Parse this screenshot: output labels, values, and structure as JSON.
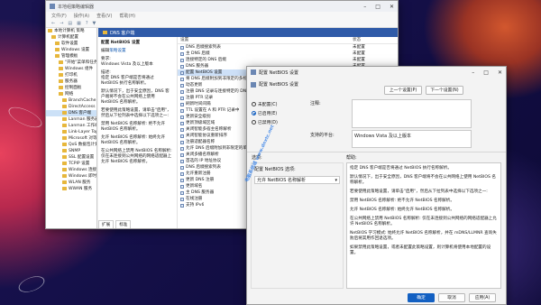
{
  "editor": {
    "title": "本地组策略编辑器",
    "menu": [
      "文件(F)",
      "操作(A)",
      "查看(V)",
      "帮助(H)"
    ],
    "tree": [
      {
        "label": "本地计算机 策略",
        "indent": 0
      },
      {
        "label": "计算机配置",
        "indent": 1
      },
      {
        "label": "软件设置",
        "indent": 2
      },
      {
        "label": "Windows 设置",
        "indent": 2
      },
      {
        "label": "管理模板",
        "indent": 2
      },
      {
        "label": "\"开始\"菜单和任务栏",
        "indent": 3
      },
      {
        "label": "Windows 组件",
        "indent": 3
      },
      {
        "label": "打印机",
        "indent": 3
      },
      {
        "label": "服务器",
        "indent": 3
      },
      {
        "label": "控制面板",
        "indent": 3
      },
      {
        "label": "网络",
        "indent": 3
      },
      {
        "label": "BranchCache",
        "indent": 4
      },
      {
        "label": "DirectAccess 客户端体验设置",
        "indent": 4
      },
      {
        "label": "DNS 客户端",
        "indent": 4,
        "selected": true
      },
      {
        "label": "Lanman 服务器",
        "indent": 4
      },
      {
        "label": "Lanman 工作站",
        "indent": 4
      },
      {
        "label": "Link-Layer Topology",
        "indent": 4
      },
      {
        "label": "Microsoft 对等网络服务",
        "indent": 4
      },
      {
        "label": "QoS 数据包计划程序",
        "indent": 4
      },
      {
        "label": "SNMP",
        "indent": 4
      },
      {
        "label": "SSL 配置设置",
        "indent": 4
      },
      {
        "label": "TCPIP 设置",
        "indent": 4
      },
      {
        "label": "Windows 连接管理器",
        "indent": 4
      },
      {
        "label": "Windows 即时连接",
        "indent": 4
      },
      {
        "label": "WLAN 服务",
        "indent": 4
      },
      {
        "label": "WWAN 服务",
        "indent": 4
      }
    ],
    "panel_header": "DNS 客户端",
    "desc": {
      "heading": "配置 NetBIOS 设置",
      "edit_prefix": "编辑",
      "edit_link": "策略设置",
      "req_label": "要求:",
      "req_value": "Windows Vista 及以上版本",
      "desc_label": "描述:",
      "desc_text": "指定 DNS 客户端是否将通过 NetBIOS 执行名称解析。",
      "default_text": "默认情况下，出于安全原因，DNS 客户端将不会在公共网络上使用 NetBIOS 名称解析。",
      "enable_text": "若要使用此策略设置，请单击\"启用\"，然后从下拉列表中选择以下选项之一:",
      "disable_text": "禁用 NetBIOS 名称解析: 绝不允许 NetBIOS 名称解析。",
      "allow_text": "允许 NetBIOS 名称解析: 始终允许 NetBIOS 名称解析。",
      "public_text": "在公共网络上禁用 NetBIOS 名称解析: 仅在未连接到公共网络的网络适配器上允许 NetBIOS 名称解析。"
    },
    "settings_col": "设置",
    "state_col": "状态",
    "settings": [
      {
        "name": "DNS 后缀搜索列表",
        "state": ""
      },
      {
        "name": "主 DNS 后缀",
        "state": ""
      },
      {
        "name": "连接特定的 DNS 后缀",
        "state": ""
      },
      {
        "name": "DNS 服务器",
        "state": ""
      },
      {
        "name": "配置 NetBIOS 设置",
        "state": "",
        "selected": true
      },
      {
        "name": "将 DNS 后缀附加到非限定的多标签名称查询",
        "state": ""
      },
      {
        "name": "动态更新",
        "state": ""
      },
      {
        "name": "注册 DNS 记录与连接特定的 DNS 后缀",
        "state": ""
      },
      {
        "name": "注册 PTR 记录",
        "state": ""
      },
      {
        "name": "刷新时间间隔",
        "state": ""
      },
      {
        "name": "TTL 设置在 A 和 PTR 记录中",
        "state": ""
      },
      {
        "name": "更新安全级别",
        "state": ""
      },
      {
        "name": "更新顶级域区域",
        "state": ""
      },
      {
        "name": "关闭智能多宿主名称解析",
        "state": ""
      },
      {
        "name": "关闭智能协议重新排序",
        "state": ""
      },
      {
        "name": "注册适配器名称",
        "state": ""
      },
      {
        "name": "允许 DNS 后缀附加到非限定的单标签名称",
        "state": ""
      },
      {
        "name": "关闭多播名称解析",
        "state": ""
      },
      {
        "name": "首选的 IP 地址协议",
        "state": ""
      },
      {
        "name": "DNS 后缀搜索列表",
        "state": ""
      },
      {
        "name": "允许重新注册",
        "state": ""
      },
      {
        "name": "更新 DNS 注册",
        "state": ""
      },
      {
        "name": "更新域名",
        "state": ""
      },
      {
        "name": "主 DNS 服务器",
        "state": ""
      },
      {
        "name": "在线注册",
        "state": ""
      },
      {
        "name": "支持 IPv6",
        "state": ""
      }
    ],
    "visible_states": [
      "未配置",
      "未配置",
      "未配置",
      "未配置"
    ],
    "tabs": [
      "扩展",
      "标准"
    ]
  },
  "dialog": {
    "title": "配置 NetBIOS 设置",
    "heading": "配置 NetBIOS 设置",
    "prev_button": "上一个设置(P)",
    "next_button": "下一个设置(N)",
    "radio_not_configured": "未配置(C)",
    "radio_enabled": "已启用(E)",
    "radio_disabled": "已禁用(D)",
    "comment_label": "注释:",
    "platform_label": "支持的平台:",
    "platform_value": "Windows Vista 及以上版本",
    "options_label": "选项:",
    "help_label": "帮助:",
    "option_name": "配置 NetBIOS 选项:",
    "option_value": "允许 NetBIOS 名称解析",
    "help": [
      "指定 DNS 客户端是否将通过 NetBIOS 执行名称解析。",
      "默认情况下，出于安全原因，DNS 客户端将不会在公共网络上使用 NetBIOS 名称解析。",
      "若要使用此策略设置，请单击\"启用\"，然后从下拉列表中选择以下选项之一:",
      "禁用 NetBIOS 名称解析: 绝不允许 NetBIOS 名称解析。",
      "允许 NetBIOS 名称解析: 始终允许 NetBIOS 名称解析。",
      "在公共网络上禁用 NetBIOS 名称解析: 仅在未连接到公共网络的网络适配器上允许 NetBIOS 名称解析。",
      "NetBIOS 学习模式: 始终允许 NetBIOS 名称解析，并在 mDNS/LLMNR 查询失败后将其用作回退选项。",
      "如果禁用此策略设置，或者未配置此策略设置，则计算机将使用本地配置的设置。"
    ],
    "ok_button": "确定",
    "cancel_button": "取消",
    "apply_button": "应用(A)"
  },
  "watermark": "电脑系统城 www.dnxtc.net",
  "colors": {
    "accent": "#1360c2",
    "selected": "#cce1f7",
    "header": "#2f5aa8"
  }
}
